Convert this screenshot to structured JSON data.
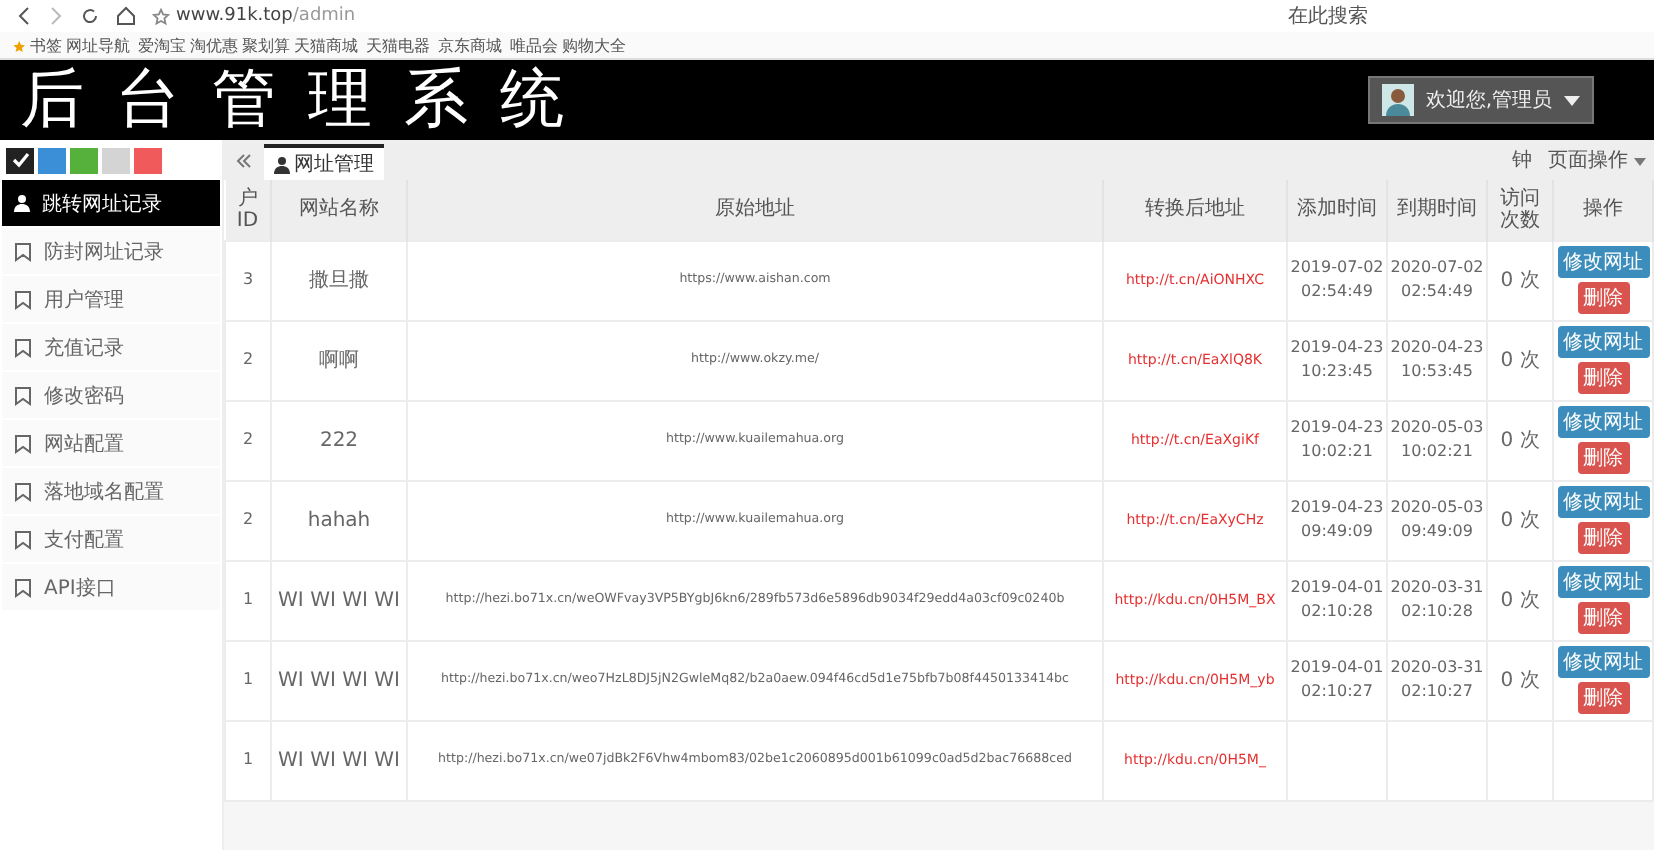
{
  "browser": {
    "address_prefix": "www.91k.top",
    "address_path": "/admin",
    "search": "在此搜索",
    "bookmarks": [
      "书签",
      "网址导航",
      "爱淘宝",
      "淘优惠",
      "聚划算",
      "天猫商城",
      "天猫电器",
      "京东商城",
      "唯品会",
      "购物大全"
    ]
  },
  "header": {
    "title": "后台管理系统",
    "user": "欢迎您,管理员"
  },
  "themes": [
    {
      "color": "#222222",
      "selected": true
    },
    {
      "color": "#3a8fd6",
      "selected": false
    },
    {
      "color": "#55b03c",
      "selected": false
    },
    {
      "color": "#d4d4d4",
      "selected": false
    },
    {
      "color": "#f05a5a",
      "selected": false
    }
  ],
  "sidebar": {
    "items": [
      {
        "label": "跳转网址记录",
        "selected": true
      },
      {
        "label": "防封网址记录",
        "selected": false
      },
      {
        "label": "用户管理",
        "selected": false
      },
      {
        "label": "充值记录",
        "selected": false
      },
      {
        "label": "修改密码",
        "selected": false
      },
      {
        "label": "网站配置",
        "selected": false
      },
      {
        "label": "落地域名配置",
        "selected": false
      },
      {
        "label": "支付配置",
        "selected": false
      },
      {
        "label": "API接口",
        "selected": false
      }
    ]
  },
  "tabs": [
    {
      "label": "网址管理",
      "selected": true
    }
  ],
  "toolbar": {
    "left": "钟",
    "menu": "页面操作"
  },
  "table": {
    "columns": [
      "户ID",
      "网站名称",
      "原始地址",
      "转换后地址",
      "添加时间",
      "到期时间",
      "访问次数",
      "操作"
    ],
    "rows": [
      {
        "id": "3",
        "name": "撒旦撒",
        "url": "https://www.aishan.com",
        "short": "http://t.cn/AiONHXC",
        "added": [
          "2019-07-02",
          "02:54:49"
        ],
        "expires": [
          "2020-07-02",
          "02:54:49"
        ],
        "visits": "0 次",
        "actions": [
          "修改网址",
          "删除"
        ]
      },
      {
        "id": "2",
        "name": "啊啊",
        "url": "http://www.okzy.me/",
        "short": "http://t.cn/EaXlQ8K",
        "added": [
          "2019-04-23",
          "10:23:45"
        ],
        "expires": [
          "2020-04-23",
          "10:53:45"
        ],
        "visits": "0 次",
        "actions": [
          "修改网址",
          "删除"
        ]
      },
      {
        "id": "2",
        "name": "222",
        "url": "http://www.kuailemahua.org",
        "short": "http://t.cn/EaXgiKf",
        "added": [
          "2019-04-23",
          "10:02:21"
        ],
        "expires": [
          "2020-05-03",
          "10:02:21"
        ],
        "visits": "0 次",
        "actions": [
          "修改网址",
          "删除"
        ]
      },
      {
        "id": "2",
        "name": "hahah",
        "url": "http://www.kuailemahua.org",
        "short": "http://t.cn/EaXyCHz",
        "added": [
          "2019-04-23",
          "09:49:09"
        ],
        "expires": [
          "2020-05-03",
          "09:49:09"
        ],
        "visits": "0 次",
        "actions": [
          "修改网址",
          "删除"
        ]
      },
      {
        "id": "1",
        "name": "WI WI WI WI",
        "url": "http://hezi.bo71x.cn/weOWFvay3VP5BYgbJ6kn6/289fb573d6e5896db9034f29edd4a03cf09c0240b",
        "short": "http://kdu.cn/0H5M_BX",
        "added": [
          "2019-04-01",
          "02:10:28"
        ],
        "expires": [
          "2020-03-31",
          "02:10:28"
        ],
        "visits": "0 次",
        "actions": [
          "修改网址",
          "删除"
        ]
      },
      {
        "id": "1",
        "name": "WI WI WI WI",
        "url": "http://hezi.bo71x.cn/weo7HzL8DJ5jN2GwleMq82/b2a0aew.094f46cd5d1e75bfb7b08f4450133414bc",
        "short": "http://kdu.cn/0H5M_yb",
        "added": [
          "2019-04-01",
          "02:10:27"
        ],
        "expires": [
          "2020-03-31",
          "02:10:27"
        ],
        "visits": "0 次",
        "actions": [
          "修改网址",
          "删除"
        ]
      },
      {
        "id": "1",
        "name": "WI WI WI WI",
        "url": "http://hezi.bo71x.cn/we07jdBk2F6Vhw4mbom83/02be1c2060895d001b61099c0ad5d2bac76688ced",
        "short": "http://kdu.cn/0H5M_"
      }
    ]
  }
}
